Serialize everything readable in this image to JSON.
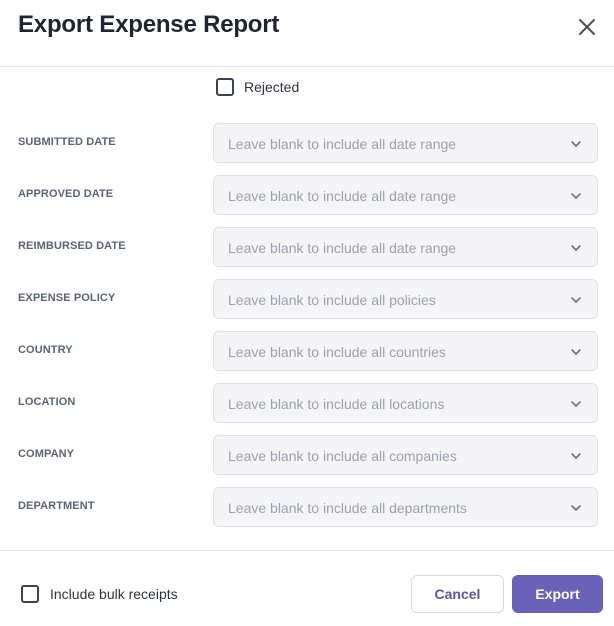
{
  "modal": {
    "title": "Export Expense Report"
  },
  "status_filter": {
    "rejected_label": "Rejected"
  },
  "filters": [
    {
      "label": "SUBMITTED DATE",
      "placeholder": "Leave blank to include all date range"
    },
    {
      "label": "APPROVED DATE",
      "placeholder": "Leave blank to include all date range"
    },
    {
      "label": "REIMBURSED DATE",
      "placeholder": "Leave blank to include all date range"
    },
    {
      "label": "EXPENSE POLICY",
      "placeholder": "Leave blank to include all policies"
    },
    {
      "label": "COUNTRY",
      "placeholder": "Leave blank to include all countries"
    },
    {
      "label": "LOCATION",
      "placeholder": "Leave blank to include all locations"
    },
    {
      "label": "COMPANY",
      "placeholder": "Leave blank to include all companies"
    },
    {
      "label": "DEPARTMENT",
      "placeholder": "Leave blank to include all departments"
    }
  ],
  "footer": {
    "bulk_receipts_label": "Include bulk receipts",
    "cancel_label": "Cancel",
    "export_label": "Export"
  },
  "colors": {
    "primary": "#6a62b8",
    "input_bg": "#f5f5f8",
    "label": "#5a6475"
  },
  "icons": {
    "close": "close-icon",
    "dropdown": "chevron-down-icon"
  }
}
